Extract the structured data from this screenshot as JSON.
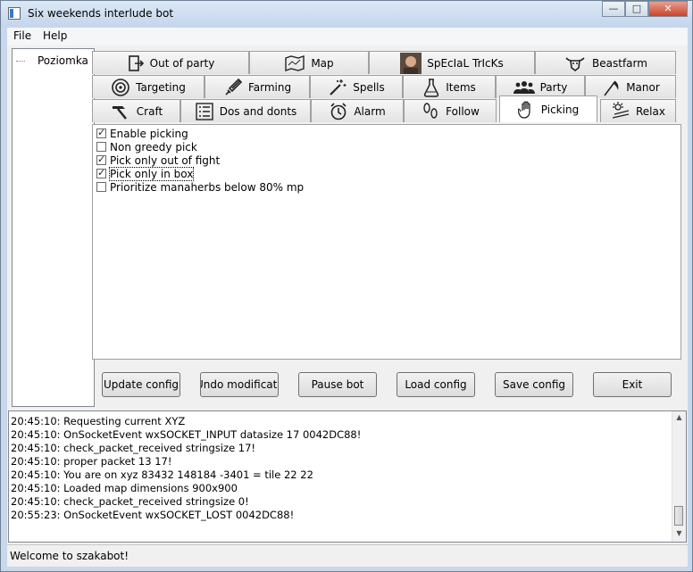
{
  "window": {
    "title": "Six weekends interlude bot"
  },
  "menu": {
    "file": "File",
    "help": "Help"
  },
  "tree": {
    "items": [
      "Poziomka"
    ]
  },
  "tabs": {
    "row1": [
      {
        "label": "Out of party",
        "icon": "exit-icon"
      },
      {
        "label": "Map",
        "icon": "map-icon"
      },
      {
        "label": "SpEcIaL TrIcKs",
        "icon": "avatar-photo-icon"
      },
      {
        "label": "Beastfarm",
        "icon": "beast-head-icon"
      }
    ],
    "row2": [
      {
        "label": "Targeting",
        "icon": "target-icon"
      },
      {
        "label": "Farming",
        "icon": "sword-icon"
      },
      {
        "label": "Spells",
        "icon": "magic-wand-icon"
      },
      {
        "label": "Items",
        "icon": "potion-flask-icon"
      },
      {
        "label": "Party",
        "icon": "people-icon"
      },
      {
        "label": "Manor",
        "icon": "scythe-icon"
      }
    ],
    "row3": [
      {
        "label": "Craft",
        "icon": "hammer-icon"
      },
      {
        "label": "Dos and donts",
        "icon": "checklist-icon"
      },
      {
        "label": "Alarm",
        "icon": "alarm-clock-icon"
      },
      {
        "label": "Follow",
        "icon": "footprints-icon"
      },
      {
        "label": "Picking",
        "icon": "hand-icon"
      },
      {
        "label": "Relax",
        "icon": "relax-sun-icon"
      }
    ],
    "active": "Picking"
  },
  "picking": {
    "options": [
      {
        "label": "Enable picking",
        "checked": true
      },
      {
        "label": "Non greedy pick",
        "checked": false
      },
      {
        "label": "Pick only out of fight",
        "checked": true
      },
      {
        "label": "Pick only in box",
        "checked": true
      },
      {
        "label": "Prioritize manaherbs below 80% mp",
        "checked": false
      }
    ]
  },
  "buttons": {
    "update": "Update config",
    "undo": "Undo modifications",
    "pause": "Pause bot",
    "load": "Load config",
    "save": "Save config",
    "exit": "Exit"
  },
  "log": {
    "lines": [
      "20:45:10: Requesting current XYZ",
      "20:45:10: OnSocketEvent wxSOCKET_INPUT datasize 17 0042DC88!",
      "20:45:10: check_packet_received stringsize 17!",
      "20:45:10: proper packet 13 17!",
      "20:45:10: You are on xyz 83432 148184 -3401 = tile 22 22",
      "20:45:10: Loaded map dimensions 900x900",
      "20:45:10: check_packet_received stringsize 0!",
      "20:55:23: OnSocketEvent wxSOCKET_LOST 0042DC88!"
    ]
  },
  "status": {
    "text": "Welcome to szakabot!"
  }
}
